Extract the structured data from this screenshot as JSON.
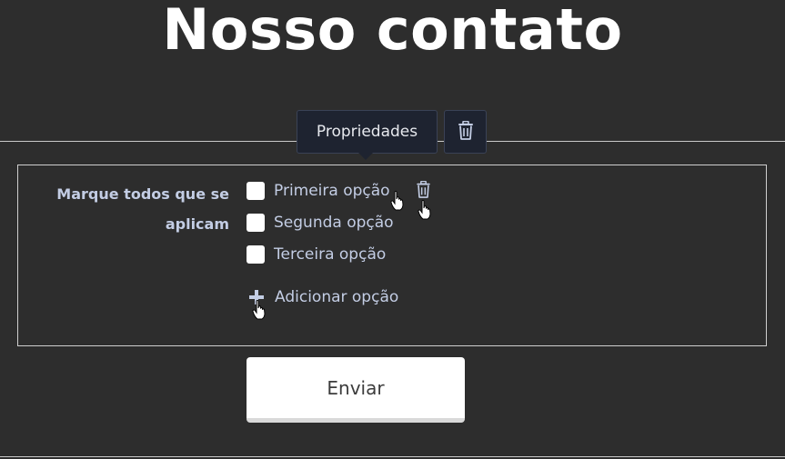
{
  "page": {
    "title": "Nosso contato"
  },
  "toolbar": {
    "properties_label": "Propriedades",
    "delete_icon": "trash-icon"
  },
  "field": {
    "label": "Marque todos que se aplicam",
    "options": [
      {
        "label": "Primeira opção",
        "checked": false
      },
      {
        "label": "Segunda opção",
        "checked": false
      },
      {
        "label": "Terceira opção",
        "checked": false
      }
    ],
    "option_delete_icon": "trash-icon",
    "add_option_label": "Adicionar opção",
    "add_option_icon": "plus-icon"
  },
  "form": {
    "submit_label": "Enviar"
  },
  "colors": {
    "background": "#2d2d2d",
    "toolbar_bg": "#1e2330",
    "label_text": "#c3cde4",
    "title_text": "#ffffff",
    "submit_bg": "#ffffff"
  }
}
